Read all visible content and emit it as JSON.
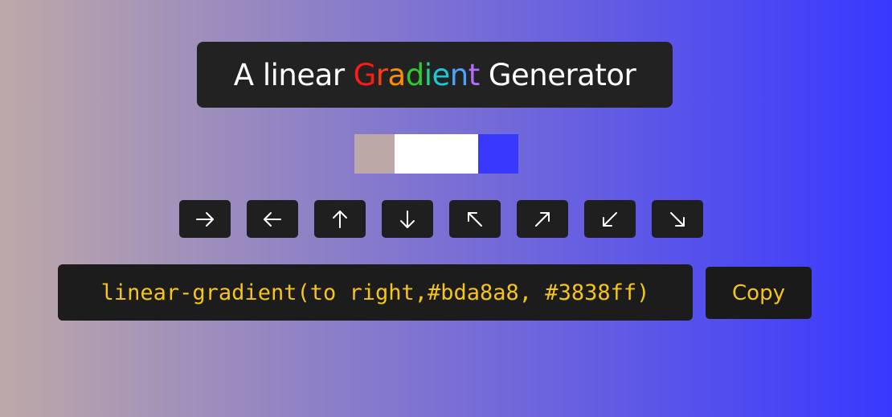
{
  "title": {
    "prefix": "A linear",
    "suffix": "Generator",
    "rainbow_letters": [
      {
        "char": "G",
        "color": "#ff1a1a"
      },
      {
        "char": "r",
        "color": "#ff3c12"
      },
      {
        "char": "a",
        "color": "#ff8c00"
      },
      {
        "char": "d",
        "color": "#2ecc2e"
      },
      {
        "char": "i",
        "color": "#1fd38a"
      },
      {
        "char": "e",
        "color": "#1cc8d8"
      },
      {
        "char": "n",
        "color": "#4aa3ff"
      },
      {
        "char": "t",
        "color": "#b06cff"
      }
    ]
  },
  "swatches": {
    "start_color": "#bda8a8",
    "middle_color": "#ffffff",
    "end_color": "#3838ff"
  },
  "directions": [
    {
      "icon": "arrow-right-icon",
      "label": "to right"
    },
    {
      "icon": "arrow-left-icon",
      "label": "to left"
    },
    {
      "icon": "arrow-up-icon",
      "label": "to top"
    },
    {
      "icon": "arrow-down-icon",
      "label": "to bottom"
    },
    {
      "icon": "arrow-up-left-icon",
      "label": "to top left"
    },
    {
      "icon": "arrow-up-right-icon",
      "label": "to top right"
    },
    {
      "icon": "arrow-down-left-icon",
      "label": "to bottom left"
    },
    {
      "icon": "arrow-down-right-icon",
      "label": "to bottom right"
    }
  ],
  "output": {
    "code": "linear-gradient(to right,#bda8a8, #3838ff)",
    "copy_label": "Copy"
  },
  "colors": {
    "panel_bg": "#222222",
    "accent_text": "#f5c518",
    "gradient_start": "#bda8a8",
    "gradient_end": "#3838ff"
  }
}
